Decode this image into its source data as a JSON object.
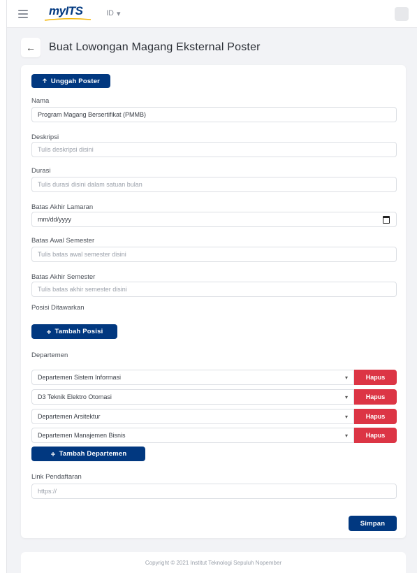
{
  "topbar": {
    "logo_text": "myITS",
    "lang_label": "ID",
    "lang_caret": "▾"
  },
  "header": {
    "back_glyph": "←",
    "title": "Buat Lowongan Magang Eksternal Poster"
  },
  "form": {
    "upload_button": "Unggah Poster",
    "name_label": "Nama",
    "name_value": "Program Magang Bersertifikat (PMMB)",
    "description_label": "Deskripsi",
    "description_placeholder": "Tulis deskripsi disini",
    "duration_label": "Durasi",
    "duration_placeholder": "Tulis durasi disini dalam satuan bulan",
    "deadline_label": "Batas Akhir Lamaran",
    "deadline_placeholder": "mm/dd/yyyy",
    "sem_start_label": "Batas Awal Semester",
    "sem_start_placeholder": "Tulis batas awal semester disini",
    "sem_end_label": "Batas Akhir Semester",
    "sem_end_placeholder": "Tulis batas akhir semester disini",
    "positions_label": "Posisi Ditawarkan",
    "add_position_button": "Tambah Posisi",
    "departments_label": "Departemen",
    "departments": [
      "Departemen Sistem Informasi",
      "D3 Teknik Elektro Otomasi",
      "Departemen Arsitektur",
      "Departemen Manajemen Bisnis"
    ],
    "remove_button": "Hapus",
    "add_department_button": "Tambah Departemen",
    "link_label": "Link Pendaftaran",
    "link_placeholder": "https://",
    "save_button": "Simpan"
  },
  "footer": {
    "text": "Copyright © 2021 Institut Teknologi Sepuluh Nopember"
  },
  "colors": {
    "primary": "#013880",
    "danger": "#dc3545"
  },
  "icons": {
    "upload": "arrow-up-icon",
    "add": "plus-icon",
    "calendar": "calendar-icon"
  }
}
